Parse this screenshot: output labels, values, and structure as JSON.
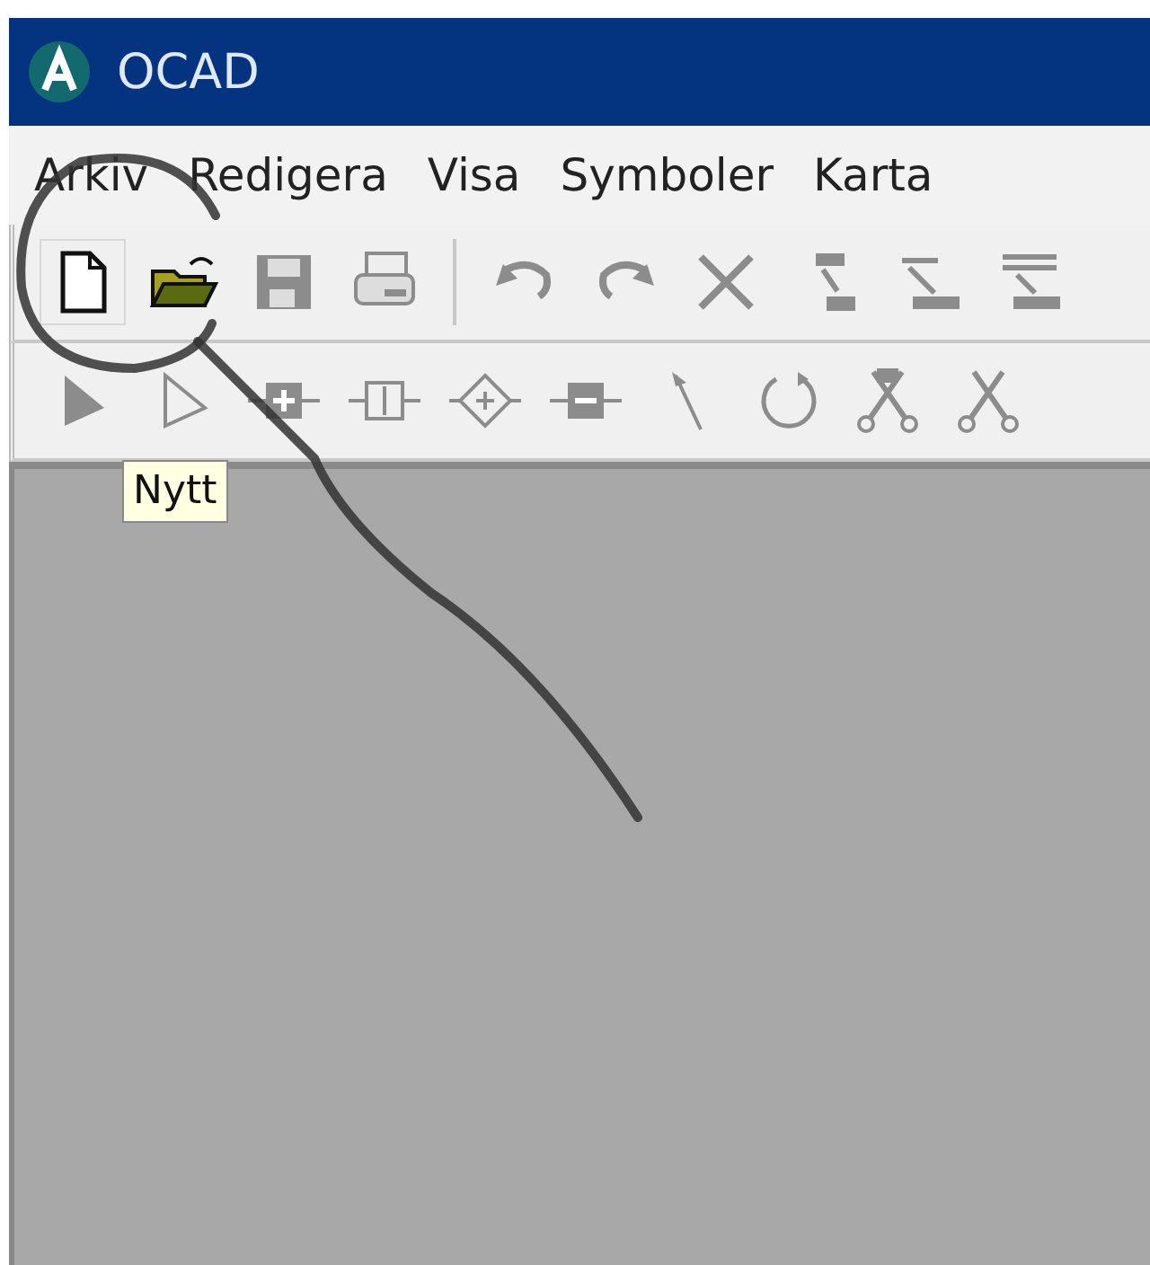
{
  "window": {
    "title": "OCAD"
  },
  "menu": [
    "Arkiv",
    "Redigera",
    "Visa",
    "Symboler",
    "Karta"
  ],
  "toolbars": [
    [
      {
        "kind": "new",
        "disabled": false
      },
      {
        "kind": "open",
        "disabled": false
      },
      {
        "kind": "save",
        "disabled": true
      },
      {
        "kind": "print",
        "disabled": true
      },
      {
        "kind": "separator"
      },
      {
        "kind": "undo",
        "disabled": true
      },
      {
        "kind": "redo",
        "disabled": true
      },
      {
        "kind": "delete",
        "disabled": true
      },
      {
        "kind": "step",
        "disabled": true
      },
      {
        "kind": "down",
        "disabled": true
      },
      {
        "kind": "lines",
        "disabled": true
      }
    ],
    [
      {
        "kind": "select",
        "disabled": true
      },
      {
        "kind": "hollow",
        "disabled": true
      },
      {
        "kind": "addvertex",
        "disabled": true
      },
      {
        "kind": "corner",
        "disabled": true
      },
      {
        "kind": "diamond",
        "disabled": true
      },
      {
        "kind": "removevertex",
        "disabled": true
      },
      {
        "kind": "pointer",
        "disabled": true
      },
      {
        "kind": "rotate",
        "disabled": true
      },
      {
        "kind": "scissorsfilled",
        "disabled": true
      },
      {
        "kind": "scissors",
        "disabled": true
      }
    ]
  ],
  "tooltip": "Nytt"
}
